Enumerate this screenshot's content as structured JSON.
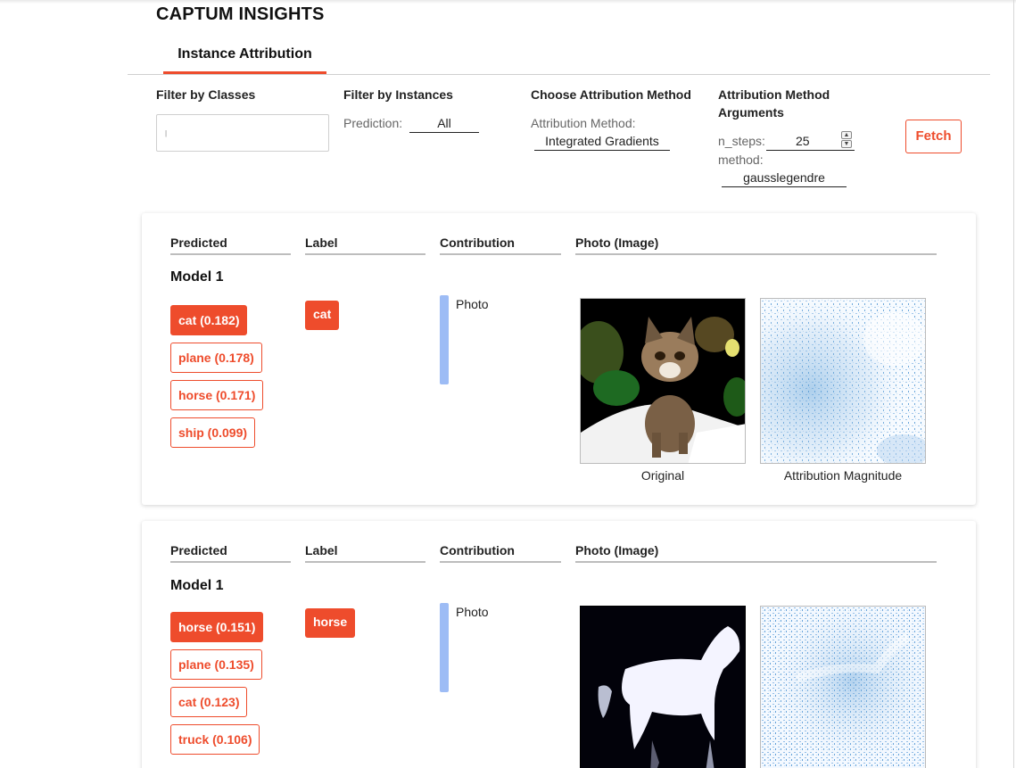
{
  "app": {
    "title": "CAPTUM INSIGHTS"
  },
  "tabs": [
    {
      "label": "Instance Attribution"
    }
  ],
  "filters": {
    "classes": {
      "heading": "Filter by Classes",
      "value": ""
    },
    "instances": {
      "heading": "Filter by Instances",
      "prediction_label": "Prediction:",
      "prediction_value": "All"
    },
    "method": {
      "heading": "Choose Attribution Method",
      "label": "Attribution Method:",
      "value": "Integrated Gradients"
    },
    "arguments": {
      "heading_line1": "Attribution Method",
      "heading_line2": "Arguments",
      "n_steps_label": "n_steps:",
      "n_steps_value": "25",
      "method_label": "method:",
      "method_value": "gausslegendre"
    },
    "fetch_label": "Fetch"
  },
  "columns": {
    "predicted": "Predicted",
    "label": "Label",
    "contribution": "Contribution",
    "photo": "Photo (Image)"
  },
  "instances": [
    {
      "model": "Model 1",
      "predictions": [
        {
          "text": "cat (0.182)",
          "active": true
        },
        {
          "text": "plane (0.178)",
          "active": false
        },
        {
          "text": "horse (0.171)",
          "active": false
        },
        {
          "text": "ship (0.099)",
          "active": false
        }
      ],
      "label": "cat",
      "contribution": "Photo",
      "original_caption": "Original",
      "attribution_caption": "Attribution Magnitude"
    },
    {
      "model": "Model 1",
      "predictions": [
        {
          "text": "horse (0.151)",
          "active": true
        },
        {
          "text": "plane (0.135)",
          "active": false
        },
        {
          "text": "cat (0.123)",
          "active": false
        },
        {
          "text": "truck (0.106)",
          "active": false
        }
      ],
      "label": "horse",
      "contribution": "Photo"
    }
  ],
  "colors": {
    "accent": "#ee4c2c",
    "contribution_bar": "#9dbcf5",
    "attribution_blue": "#1f6fb4"
  }
}
